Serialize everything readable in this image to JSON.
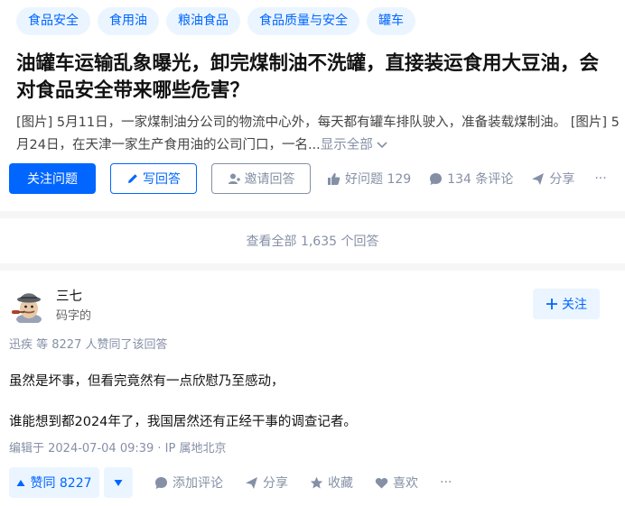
{
  "question": {
    "tags": [
      "食品安全",
      "食用油",
      "粮油食品",
      "食品质量与安全",
      "罐车"
    ],
    "title": "油罐车运输乱象曝光，卸完煤制油不洗罐，直接装运食用大豆油，会对食品安全带来哪些危害？",
    "excerpt": "[图片] 5月11日，一家煤制油分公司的物流中心外，每天都有罐车排队驶入，准备装载煤制油。 [图片] 5月24日，在天津一家生产食用油的公司门口，一名...",
    "show_all": "显示全部",
    "follow_label": "关注问题",
    "write_label": "写回答",
    "invite_label": "邀请回答",
    "good_question": "好问题 129",
    "comments": "134 条评论",
    "share": "分享",
    "more": "···"
  },
  "view_all": "查看全部 1,635 个回答",
  "answer": {
    "author_name": "三七",
    "author_bio": "码字的",
    "follow_label": "关注",
    "voters": "迅疾 等 8227 人赞同了该回答",
    "paragraphs": [
      "虽然是坏事，但看完竟然有一点欣慰乃至感动，",
      "谁能想到都2024年了，我国居然还有正经干事的调查记者。"
    ],
    "edit_info": "编辑于 2024-07-04 09:39 · IP 属地北京",
    "upvote_label": "赞同 8227",
    "add_comment": "添加评论",
    "share": "分享",
    "favorite": "收藏",
    "like": "喜欢",
    "more": "···"
  },
  "colors": {
    "brand": "#0066ff",
    "brand_light": "#ebf5ff",
    "muted": "#8590a6"
  }
}
